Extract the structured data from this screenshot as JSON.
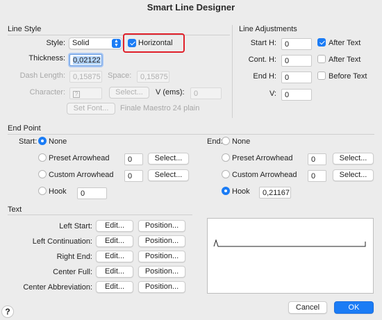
{
  "window": {
    "title": "Smart Line Designer"
  },
  "line_style": {
    "section_label": "Line Style",
    "style_label": "Style:",
    "style_value": "Solid",
    "horizontal_label": "Horizontal",
    "horizontal_checked": true,
    "thickness_label": "Thickness:",
    "thickness_value": "0,02122",
    "dash_length_label": "Dash Length:",
    "dash_length_value": "0,15875",
    "space_label": "Space:",
    "space_value": "0,15875",
    "character_label": "Character:",
    "character_value": "?",
    "select_label": "Select...",
    "v_ems_label": "V (ems):",
    "v_ems_value": "0",
    "set_font_label": "Set Font...",
    "font_info": "Finale Maestro 24 plain"
  },
  "line_adjustments": {
    "section_label": "Line Adjustments",
    "start_h_label": "Start H:",
    "start_h_value": "0",
    "cont_h_label": "Cont. H:",
    "cont_h_value": "0",
    "end_h_label": "End H:",
    "end_h_value": "0",
    "v_label": "V:",
    "v_value": "0",
    "after_text_1_label": "After Text",
    "after_text_1_checked": true,
    "after_text_2_label": "After Text",
    "after_text_2_checked": false,
    "before_text_label": "Before Text",
    "before_text_checked": false
  },
  "end_point": {
    "section_label": "End Point",
    "start": {
      "label": "Start:",
      "none_label": "None",
      "preset_label": "Preset Arrowhead",
      "preset_value": "0",
      "custom_label": "Custom Arrowhead",
      "custom_value": "0",
      "hook_label": "Hook",
      "hook_value": "0",
      "select_label": "Select...",
      "selected": "none"
    },
    "end": {
      "label": "End:",
      "none_label": "None",
      "preset_label": "Preset Arrowhead",
      "preset_value": "0",
      "custom_label": "Custom Arrowhead",
      "custom_value": "0",
      "hook_label": "Hook",
      "hook_value": "0,21167",
      "select_label": "Select...",
      "selected": "hook"
    }
  },
  "text": {
    "section_label": "Text",
    "edit_label": "Edit...",
    "position_label": "Position...",
    "rows": [
      {
        "label": "Left Start:"
      },
      {
        "label": "Left Continuation:"
      },
      {
        "label": "Right End:"
      },
      {
        "label": "Center Full:"
      },
      {
        "label": "Center Abbreviation:"
      }
    ]
  },
  "footer": {
    "help_label": "?",
    "cancel_label": "Cancel",
    "ok_label": "OK"
  },
  "colors": {
    "accent": "#1b7cf5",
    "highlight_box": "#e0202a",
    "background": "#ececec"
  }
}
